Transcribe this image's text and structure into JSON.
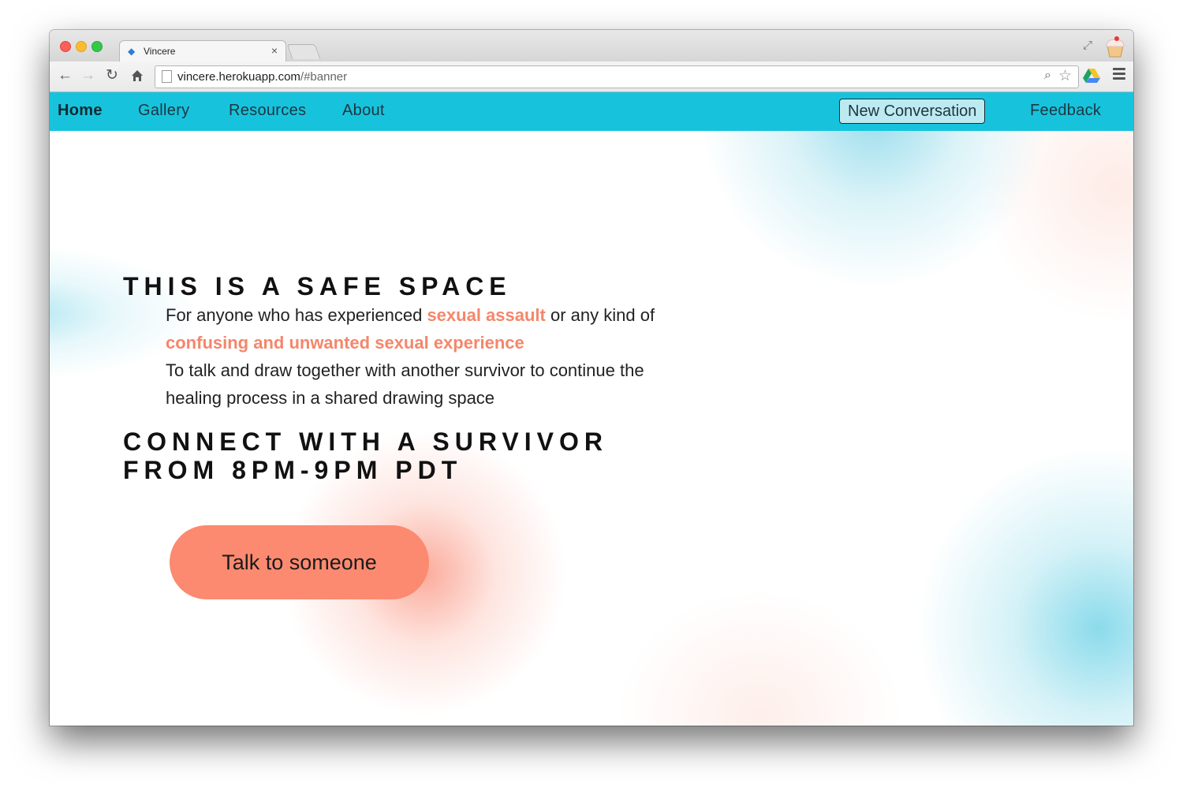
{
  "browser": {
    "tab_title": "Vincere",
    "tab_close": "×",
    "url_host": "vincere.herokuapp.com",
    "url_path": "/#banner"
  },
  "nav": {
    "home": "Home",
    "gallery": "Gallery",
    "resources": "Resources",
    "about": "About",
    "new_conversation": "New Conversation",
    "feedback": "Feedback"
  },
  "hero": {
    "heading1": "THIS IS A SAFE SPACE",
    "line1_a": "For anyone who has experienced ",
    "line1_highlight": "sexual assault",
    "line1_b": " or any kind of ",
    "line1_highlight2": "confusing and unwanted sexual experience",
    "line2": "To talk and draw together with another survivor to continue the healing process in a shared drawing space",
    "heading2": "CONNECT WITH A SURVIVOR FROM 8PM-9PM PDT",
    "cta": "Talk to someone"
  },
  "colors": {
    "navbar": "#17c3dc",
    "accent": "#fb8a70",
    "highlight_text": "#f5866a"
  },
  "icons": {
    "back": "back-arrow-icon",
    "forward": "forward-arrow-icon",
    "reload": "reload-icon",
    "home": "home-icon",
    "zoom": "magnifier-icon",
    "star": "star-icon",
    "drive": "drive-icon",
    "menu": "hamburger-menu-icon"
  }
}
